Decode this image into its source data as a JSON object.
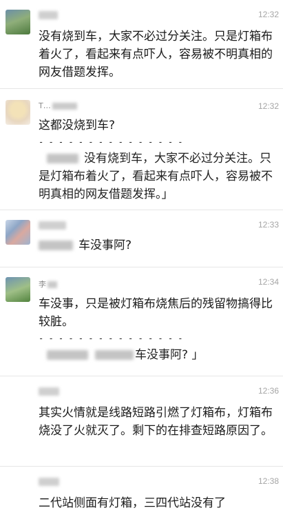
{
  "comments": [
    {
      "time": "12:32",
      "text": "没有烧到车，大家不必过分关注。只是灯箱布着火了，看起来有点吓人，容易被不明真相的网友借题发挥。"
    },
    {
      "user": "T…",
      "time": "12:32",
      "text": "这都没烧到车?",
      "separator": "- - - - - - - - - - - - - - -",
      "quote": "没有烧到车，大家不必过分关注。只是灯箱布着火了，看起来有点吓人，容易被不明真相的网友借题发挥。」"
    },
    {
      "time": "12:33",
      "text": "车没事阿?"
    },
    {
      "user": "李",
      "time": "12:34",
      "text": "车没事，只是被灯箱布烧焦后的残留物搞得比较脏。",
      "separator": "- - - - - - - - - - - - - - -",
      "quote": "车没事阿? 」"
    },
    {
      "time": "12:36",
      "text": "其实火情就是线路短路引燃了灯箱布，灯箱布烧没了火就灭了。剩下的在排查短路原因了。"
    },
    {
      "time": "12:38",
      "text": "二代站侧面有灯箱，三四代站没有了"
    }
  ]
}
